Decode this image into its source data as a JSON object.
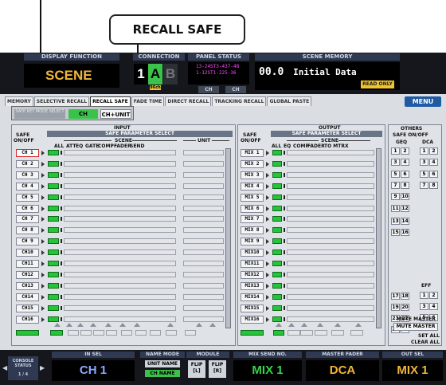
{
  "callout": {
    "label": "RECALL SAFE"
  },
  "topbar": {
    "display_function": "DISPLAY FUNCTION",
    "function_name": "SCENE",
    "connection_label": "CONNECTION",
    "connection_num": "1",
    "layer_a": "A",
    "layer_b": "B",
    "connection_badge": "96ch",
    "panel_status_label": "PANEL STATUS",
    "panel_lines": [
      "13-24ST3-437-48",
      "1-12ST1-225-36"
    ],
    "panel_ch": [
      "CH",
      "CH"
    ],
    "scene_memory_label": "SCENE MEMORY",
    "scene_number": "00.0",
    "scene_title": "Initial Data",
    "read_only": "READ ONLY"
  },
  "tabs": [
    "MEMORY",
    "SELECTIVE RECALL",
    "RECALL SAFE",
    "FADE TIME",
    "DIRECT RECALL",
    "TRACKING RECALL",
    "GLOBAL PASTE"
  ],
  "active_tab": "RECALL SAFE",
  "menu": "MENU",
  "mode": {
    "key_label": "SAFE KEY MODE SELECT",
    "ch": "CH",
    "ch_unit": "CH+UNIT"
  },
  "input": {
    "title": "INPUT",
    "subtitle": "SAFE PARAMETER SELECT",
    "safe": "SAFE",
    "onoff": "ON/OFF",
    "scene": "SCENE",
    "unit": "UNIT",
    "cols": [
      "ALL",
      "ATT",
      "EQ",
      "GATE",
      "COMP",
      "FADER",
      "SEND"
    ],
    "channels": [
      "CH 1",
      "CH 2",
      "CH 3",
      "CH 4",
      "CH 5",
      "CH 6",
      "CH 7",
      "CH 8",
      "CH 9",
      "CH10",
      "CH11",
      "CH12",
      "CH13",
      "CH14",
      "CH15",
      "CH16"
    ]
  },
  "output": {
    "title": "OUTPUT",
    "subtitle": "SAFE PARAMETER SELECT",
    "safe": "SAFE",
    "onoff": "ON/OFF",
    "scene": "SCENE",
    "cols": [
      "ALL",
      "EQ",
      "COMP",
      "FADER",
      "TO MTRX"
    ],
    "channels": [
      "MIX 1",
      "MIX 2",
      "MIX 3",
      "MIX 4",
      "MIX 5",
      "MIX 6",
      "MIX 7",
      "MIX 8",
      "MIX 9",
      "MIX10",
      "MIX11",
      "MIX12",
      "MIX13",
      "MIX14",
      "MIX15",
      "MIX16"
    ]
  },
  "others": {
    "title": "OTHERS",
    "safe": "SAFE ON/OFF",
    "geq": "GEQ",
    "dca": "DCA",
    "geq_buttons": [
      "1",
      "2",
      "3",
      "4",
      "5",
      "6",
      "7",
      "8",
      "9",
      "10",
      "11",
      "12",
      "13",
      "14",
      "15",
      "16",
      "17",
      "18",
      "19",
      "20",
      "21",
      "22",
      "23",
      "24"
    ],
    "dca_buttons": [
      "1",
      "2",
      "3",
      "4",
      "5",
      "6",
      "7",
      "8"
    ],
    "eff": "EFF",
    "eff_buttons": [
      "1",
      "2",
      "3",
      "4",
      "5",
      "6"
    ],
    "mute_master_header": "MUTE MASTER",
    "mute_master": "MUTE MASTER",
    "set_all": "SET ALL",
    "clear_all": "CLEAR ALL"
  },
  "bottom": {
    "console_status": "CONSOLE STATUS",
    "console_page": "1 / 4",
    "in_sel_label": "IN SEL",
    "in_sel": "CH 1",
    "name_mode_label": "NAME MODE",
    "unit_name": "UNIT NAME",
    "ch_name": "CH NAME",
    "module_label": "MODULE",
    "flip_l": "FLIP [L]",
    "flip_r": "FLIP [R]",
    "mix_send_label": "MIX SEND NO.",
    "mix_send": "MIX 1",
    "master_fader_label": "MASTER FADER",
    "master_fader": "DCA",
    "out_sel_label": "OUT SEL",
    "out_sel": "MIX 1"
  }
}
